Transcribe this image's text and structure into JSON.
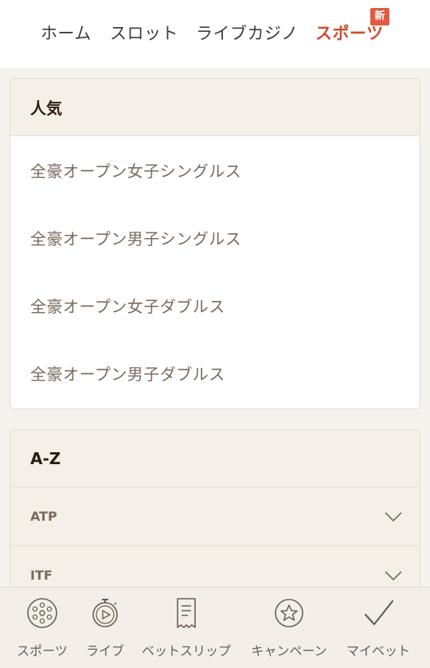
{
  "topnav": {
    "tabs": [
      {
        "label": "ホーム",
        "active": false
      },
      {
        "label": "スロット",
        "active": false
      },
      {
        "label": "ライブカジノ",
        "active": false
      },
      {
        "label": "スポーツ",
        "active": true
      }
    ],
    "new_badge": "新"
  },
  "popular": {
    "title": "人気",
    "items": [
      "全豪オープン女子シングルス",
      "全豪オープン男子シングルス",
      "全豪オープン女子ダブルス",
      "全豪オープン男子ダブルス"
    ]
  },
  "az": {
    "title": "A-Z",
    "items": [
      "ATP",
      "ITF"
    ]
  },
  "bottomnav": {
    "items": [
      {
        "label": "スポーツ",
        "icon": "soccer-ball-icon"
      },
      {
        "label": "ライブ",
        "icon": "stopwatch-icon"
      },
      {
        "label": "ベットスリップ",
        "icon": "receipt-icon"
      },
      {
        "label": "キャンペーン",
        "icon": "star-badge-icon"
      },
      {
        "label": "マイベット",
        "icon": "checkmark-icon"
      }
    ]
  },
  "colors": {
    "accent": "#d34b2c",
    "badge": "#e25a3f",
    "card_header_bg": "#f4f0e8",
    "muted_text": "#7a6b5e"
  }
}
